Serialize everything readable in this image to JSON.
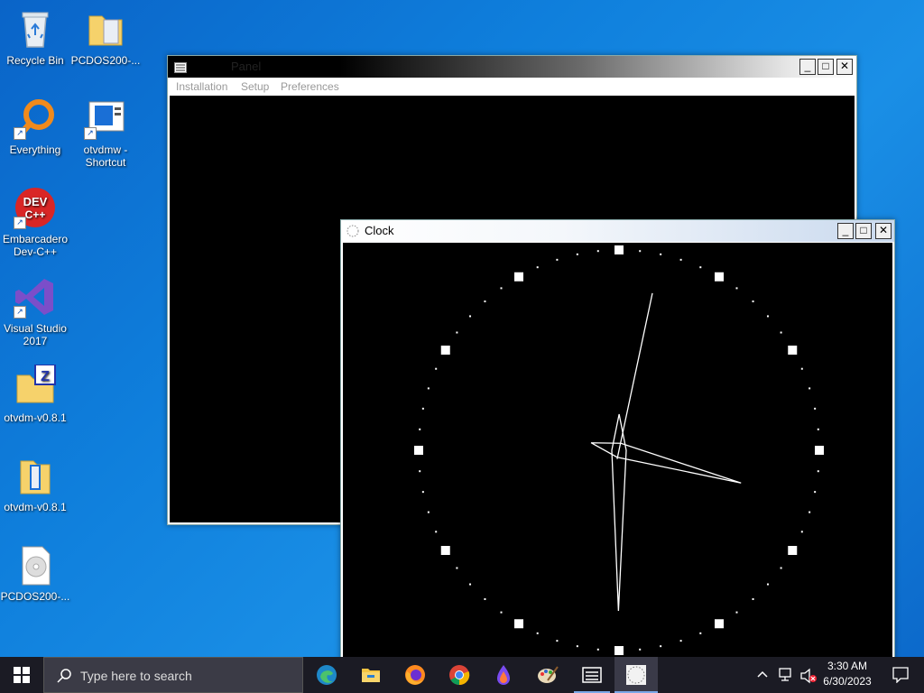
{
  "desktop": {
    "icons": [
      {
        "label": "Recycle Bin"
      },
      {
        "label": "PCDOS200-..."
      },
      {
        "label": "Everything"
      },
      {
        "label": "otvdmw - Shortcut"
      },
      {
        "label": "Embarcadero Dev-C++"
      },
      {
        "label": "Visual Studio 2017"
      },
      {
        "label": "otvdm-v0.8.1"
      },
      {
        "label": "otvdm-v0.8.1"
      },
      {
        "label": "PCDOS200-..."
      }
    ]
  },
  "panel_window": {
    "title": "Panel",
    "menu": [
      "Installation",
      "Setup",
      "Preferences"
    ],
    "buttons": {
      "minimize": "_",
      "maximize": "□",
      "close": "✕"
    }
  },
  "clock_window": {
    "title": "Clock",
    "buttons": {
      "minimize": "_",
      "maximize": "□",
      "close": "✕"
    },
    "time": {
      "hour": 3,
      "minute": 30,
      "second": 2
    }
  },
  "taskbar": {
    "search_placeholder": "Type here to search",
    "tray_time": "3:30 AM",
    "tray_date": "6/30/2023",
    "apps": [
      "edge-icon",
      "file-explorer-icon",
      "firefox-icon",
      "chrome-icon",
      "paint-3d-icon",
      "paint-icon",
      "panel-app-icon",
      "clock-app-icon"
    ]
  }
}
